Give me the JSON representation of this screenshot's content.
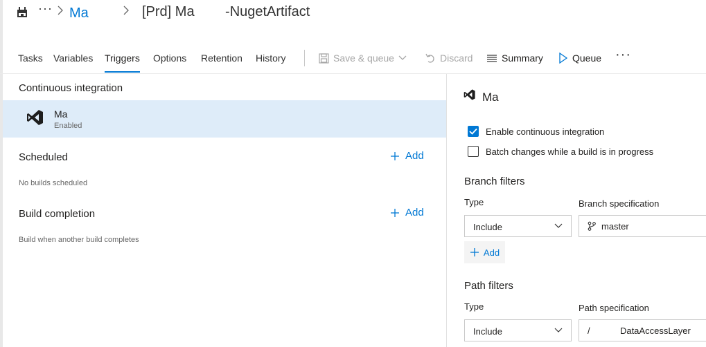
{
  "breadcrumb": {
    "overflow": "···",
    "project": "Ma",
    "pipeline": "[Prd] Ma        -NugetArtifact"
  },
  "tabs": [
    {
      "label": "Tasks"
    },
    {
      "label": "Variables"
    },
    {
      "label": "Triggers",
      "active": true
    },
    {
      "label": "Options"
    },
    {
      "label": "Retention"
    },
    {
      "label": "History"
    }
  ],
  "toolbar": {
    "save_queue": "Save & queue",
    "discard": "Discard",
    "summary": "Summary",
    "queue": "Queue",
    "more": "···"
  },
  "left": {
    "ci_title": "Continuous integration",
    "ci_item": {
      "name": "Ma",
      "status": "Enabled"
    },
    "scheduled_title": "Scheduled",
    "scheduled_add": "Add",
    "scheduled_empty": "No builds scheduled",
    "completion_title": "Build completion",
    "completion_add": "Add",
    "completion_desc": "Build when another build completes"
  },
  "right": {
    "title": "Ma",
    "enable_ci": {
      "label": "Enable continuous integration",
      "checked": true
    },
    "batch": {
      "label": "Batch changes while a build is in progress",
      "checked": false
    },
    "branch_filters": {
      "title": "Branch filters",
      "type_label": "Type",
      "spec_label": "Branch specification",
      "type_value": "Include",
      "spec_value": "master",
      "add_label": "Add"
    },
    "path_filters": {
      "title": "Path filters",
      "type_label": "Type",
      "spec_label": "Path specification",
      "type_value": "Include",
      "spec_value": "/            DataAccessLayer"
    }
  },
  "colors": {
    "accent": "#0078d4",
    "selected_bg": "#deecf9",
    "vs_purple": "#1e1e1e"
  }
}
